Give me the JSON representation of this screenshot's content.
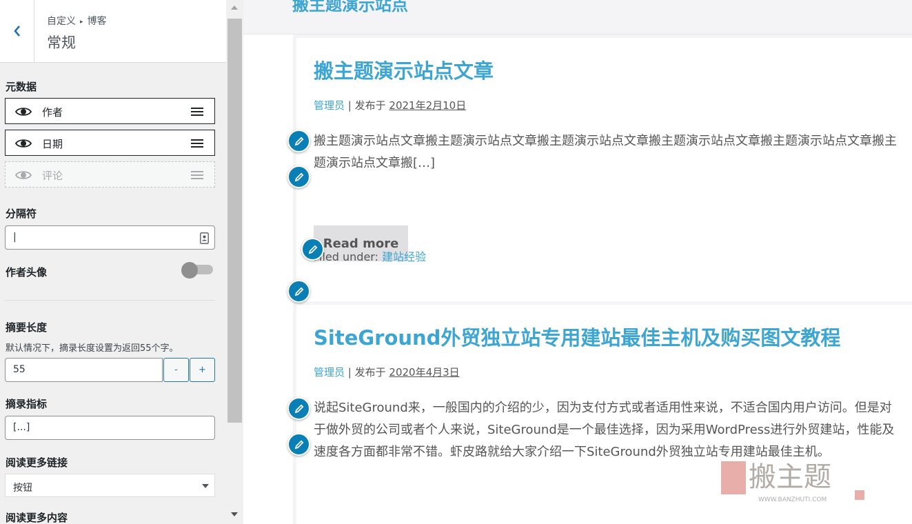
{
  "header": {
    "breadcrumb": [
      "自定义",
      "博客"
    ],
    "title": "常规"
  },
  "sidebar": {
    "meta_section_label": "元数据",
    "meta_items": [
      {
        "label": "作者",
        "visible": true
      },
      {
        "label": "日期",
        "visible": true
      },
      {
        "label": "评论",
        "visible": false
      }
    ],
    "separator_label": "分隔符",
    "separator_value": "|",
    "author_avatar_label": "作者头像",
    "author_avatar_enabled": false,
    "excerpt_length_label": "摘要长度",
    "excerpt_length_desc": "默认情况下，摘录长度设置为返回55个字。",
    "excerpt_length_value": "55",
    "decrement_label": "-",
    "increment_label": "+",
    "excerpt_indicator_label": "摘录指标",
    "excerpt_indicator_value": "[...]",
    "read_more_link_label": "阅读更多链接",
    "read_more_link_value": "按钮",
    "read_more_content_label": "阅读更多内容"
  },
  "preview": {
    "site_title": "搬主题演示站点",
    "posts": [
      {
        "title": "搬主题演示站点文章",
        "author": "管理员",
        "published_prefix": "发布于",
        "date": "2021年2月10日",
        "excerpt": "搬主题演示站点文章搬主题演示站点文章搬主题演示站点文章搬主题演示站点文章搬主题演示站点文章搬主题演示站点文章搬[…]",
        "read_more": "Read more",
        "filed_under": "Filed under:",
        "category": "建站经验"
      },
      {
        "title": "SiteGround外贸独立站专用建站最佳主机及购买图文教程",
        "author": "管理员",
        "published_prefix": "发布于",
        "date": "2020年4月3日",
        "excerpt": "说起SiteGround来，一般国内的介绍的少，因为支付方式或者适用性来说，不适合国内用户访问。但是对于做外贸的公司或者个人来说，SiteGround是一个最佳选择，因为采用WordPress进行外贸建站，性能及速度各方面都非常不错。虾皮路就给大家介绍一下SiteGround外贸独立站专用建站最佳主机。"
      }
    ],
    "watermark": {
      "text": "搬主题",
      "url": "WWW.BANZHUTI.COM"
    }
  },
  "colors": {
    "accent": "#3ca5d1",
    "edit_shortcut": "#0a7fb5",
    "customizer_blue": "#2271b1"
  },
  "icons": [
    "chevron-left-icon",
    "eye-icon",
    "drag-handle-icon",
    "contact-card-icon",
    "pencil-icon",
    "caret-down-icon",
    "scroll-up-icon",
    "scroll-down-icon"
  ]
}
